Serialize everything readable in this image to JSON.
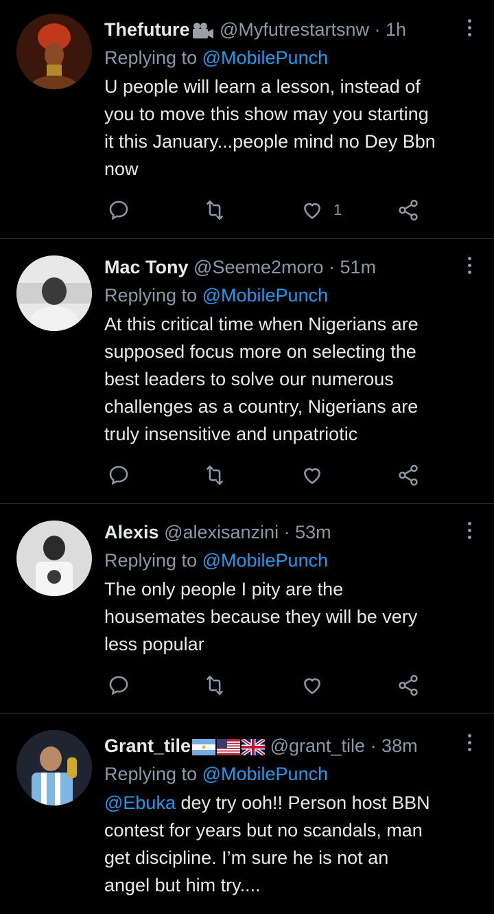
{
  "tweets": [
    {
      "name": "Thefuture",
      "emoji": "camera-emoji",
      "handle": "@Myfutrestartsnw",
      "time": "· 1h",
      "replying_prefix": "Replying to ",
      "replying_to": "@MobilePunch",
      "lines": [
        "U people will learn a lesson, instead of",
        "you to move this show may you starting",
        "it this January...people mind no Dey Bbn",
        "now"
      ],
      "likes": "1"
    },
    {
      "name": "Mac Tony",
      "handle": "@Seeme2moro",
      "time": "· 51m",
      "replying_prefix": "Replying to ",
      "replying_to": "@MobilePunch",
      "lines": [
        "At this critical time when Nigerians are",
        "supposed focus more on selecting the",
        "best leaders to solve our numerous",
        "challenges as a country, Nigerians are",
        "truly insensitive and unpatriotic"
      ],
      "likes": ""
    },
    {
      "name": "Alexis",
      "handle": "@alexisanzini",
      "time": "· 53m",
      "replying_prefix": "Replying to ",
      "replying_to": "@MobilePunch",
      "lines": [
        "The only people I pity are the",
        "housemates because they will be very",
        "less popular"
      ],
      "likes": ""
    },
    {
      "name": "Grant_tile",
      "flags": [
        "argentina-flag",
        "usa-flag",
        "uk-flag"
      ],
      "handle": "@grant_tile",
      "time": "· 38m",
      "replying_prefix": "Replying to ",
      "replying_to": "@MobilePunch",
      "mention": "@Ebuka",
      "first_line_rest": " dey try ooh!! Person host BBN",
      "lines": [
        "contest for years but no scandals, man",
        "get discipline. I’m sure he is not an",
        "angel but him try...."
      ]
    }
  ],
  "colors": {
    "background": "#000000",
    "text": "#e7e9ea",
    "muted": "#8b98a5",
    "accent": "#1d9bf0",
    "divider": "#2f3336"
  }
}
